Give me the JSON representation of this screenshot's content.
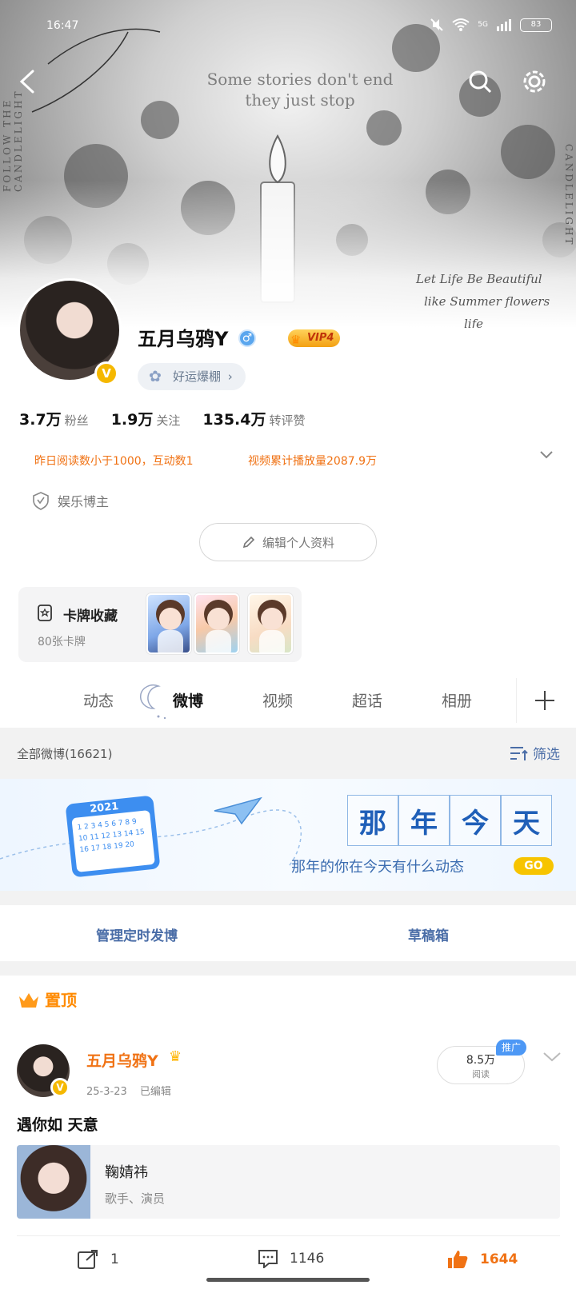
{
  "status_bar": {
    "time": "16:47",
    "battery": "83",
    "network": "5G"
  },
  "banner": {
    "quote_line1": "Some stories don't end",
    "quote_line2": "they just stop",
    "side_left": "FOLLOW THE CANDLELIGHT",
    "side_right": "CANDLELIGHT",
    "script_line1": "Let Life Be Beautiful",
    "script_line2": "like Summer flowers",
    "script_line3": "life"
  },
  "profile": {
    "name": "五月乌鸦Y",
    "vip_label": "VIP4",
    "luck_label": "好运爆棚",
    "stats": [
      {
        "num": "3.7万",
        "label": "粉丝"
      },
      {
        "num": "1.9万",
        "label": "关注"
      },
      {
        "num": "135.4万",
        "label": "转评赞"
      }
    ],
    "info_1": "昨日阅读数小于1000，互动数1",
    "info_2": "视频累计播放量2087.9万",
    "role": "娱乐博主",
    "edit_label": "编辑个人资料"
  },
  "cards": {
    "title": "卡牌收藏",
    "count": "80张卡牌"
  },
  "tabs": [
    {
      "label": "动态"
    },
    {
      "label": "微博"
    },
    {
      "label": "视频"
    },
    {
      "label": "超话"
    },
    {
      "label": "相册"
    }
  ],
  "filter": {
    "all_label": "全部微博(16621)",
    "filter_label": "筛选"
  },
  "memory": {
    "chars": [
      "那",
      "年",
      "今",
      "天"
    ],
    "subtitle": "那年的你在今天有什么动态",
    "go_label": "GO",
    "calendar_year": "2021",
    "calendar_dates": "1 2 3 4 5 6 7 8 9 10 11 12 13 14 15 16 17 18 19 20"
  },
  "actions": {
    "scheduled": "管理定时发博",
    "drafts": "草稿箱"
  },
  "pinned": {
    "label": "置顶"
  },
  "post": {
    "author": "五月乌鸦Y",
    "time": "25-3-23",
    "edited": "已编辑",
    "reads": "8.5万",
    "reads_label": "阅读",
    "promo": "推广",
    "text": "遇你如  天意",
    "card_name": "鞠婧祎",
    "card_desc": "歌手、演员",
    "shares": "1",
    "comments": "1146",
    "likes": "1644"
  },
  "colors": {
    "accent_orange": "#f07214",
    "link_blue": "#4a6da7",
    "vip_gold": "#f5b800"
  }
}
